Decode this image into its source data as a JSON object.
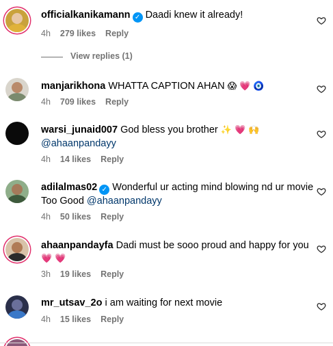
{
  "comments": [
    {
      "username": "officialkanikamann",
      "verified": true,
      "text": "Daadi knew it already!",
      "text2": "",
      "time": "4h",
      "likes": "279 likes",
      "reply": "Reply",
      "view_replies": "View replies (1)"
    },
    {
      "username": "manjarikhona",
      "text": "WHATTA CAPTION AHAN",
      "emojis": [
        "😱",
        "💗",
        "🧿"
      ],
      "time": "4h",
      "likes": "709 likes",
      "reply": "Reply"
    },
    {
      "username": "warsi_junaid007",
      "text": "God bless you brother",
      "emojis": [
        "✨",
        "💗",
        "🙌"
      ],
      "mention": "@ahaanpandayy",
      "time": "4h",
      "likes": "14 likes",
      "reply": "Reply"
    },
    {
      "username": "adilalmas02",
      "verified": true,
      "text": "Wonderful ur acting mind blowing nd ur movie",
      "text2": "Too Good",
      "mention": "@ahaanpandayy",
      "time": "4h",
      "likes": "50 likes",
      "reply": "Reply"
    },
    {
      "username": "ahaanpandayfa",
      "text": "Dadi must be sooo proud and happy for you",
      "emojis": [
        "💗",
        "💗"
      ],
      "time": "3h",
      "likes": "19 likes",
      "reply": "Reply"
    },
    {
      "username": "mr_utsav_2o",
      "text": "i am waiting for next movie",
      "time": "4h",
      "likes": "15 likes",
      "reply": "Reply"
    }
  ],
  "icons": {
    "like": "heart-outline-icon",
    "verified": "verified-badge-icon"
  },
  "colors": {
    "verified": "#0095f6",
    "mention": "#00376b",
    "meta": "#737373",
    "story_ring": "#e1306c"
  }
}
